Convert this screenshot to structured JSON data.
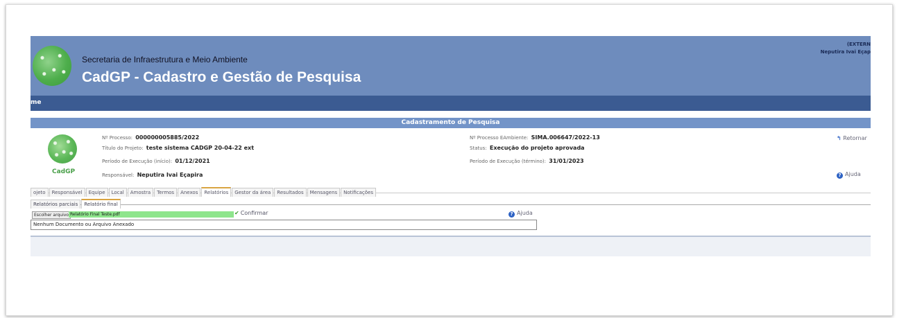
{
  "header": {
    "org_name": "Secretaria de Infraestrutura e Meio Ambiente",
    "app_title": "CadGP - Cadastro e Gestão de Pesquisa",
    "ext_label": "(EXTERN",
    "user_name": "Neputira Ivai Eçap"
  },
  "nav": {
    "home": "me"
  },
  "section": {
    "title": "Cadastramento de Pesquisa"
  },
  "logo_label": "CadGP",
  "fields": {
    "processo_label": "Nº Processo:",
    "processo_value": "000000005885/2022",
    "titulo_label": "Título do Projeto:",
    "titulo_value": "teste sistema CADGP 20-04-22 ext",
    "inicio_label": "Período de Execução (início):",
    "inicio_value": "01/12/2021",
    "responsavel_label": "Responsável:",
    "responsavel_value": "Neputira Ivai Eçapira",
    "eambiente_label": "Nº Processo EAmbiente:",
    "eambiente_value": "SIMA.006647/2022-13",
    "status_label": "Status:",
    "status_value": "Execução do projeto aprovada",
    "termino_label": "Período de Execução (término):",
    "termino_value": "31/01/2023"
  },
  "links": {
    "retornar": "Retornar",
    "ajuda": "Ajuda"
  },
  "tabs": [
    "ojeto",
    "Responsável",
    "Equipe",
    "Local",
    "Amostra",
    "Termos",
    "Anexos",
    "Relatórios",
    "Gestor da área",
    "Resultados",
    "Mensagens",
    "Notificações"
  ],
  "subtabs": [
    "Relatórios parciais",
    "Relatório final"
  ],
  "upload": {
    "choose_button": "Escolher arquivo",
    "file_name": "Relatório Final Teste.pdf",
    "confirm": "Confirmar",
    "help": "Ajuda"
  },
  "documents": {
    "empty_message": "Nenhum Documento ou Arquivo Anexado"
  },
  "colors": {
    "header_bg": "#6e8cbd",
    "nav_bg": "#3b5b92",
    "section_bg": "#7394c8",
    "file_bg": "#8ee58c",
    "check_green": "#3a9c2c",
    "help_blue": "#2d62c4"
  },
  "icons": [
    "retornar-icon",
    "help-icon",
    "check-icon",
    "logo"
  ]
}
